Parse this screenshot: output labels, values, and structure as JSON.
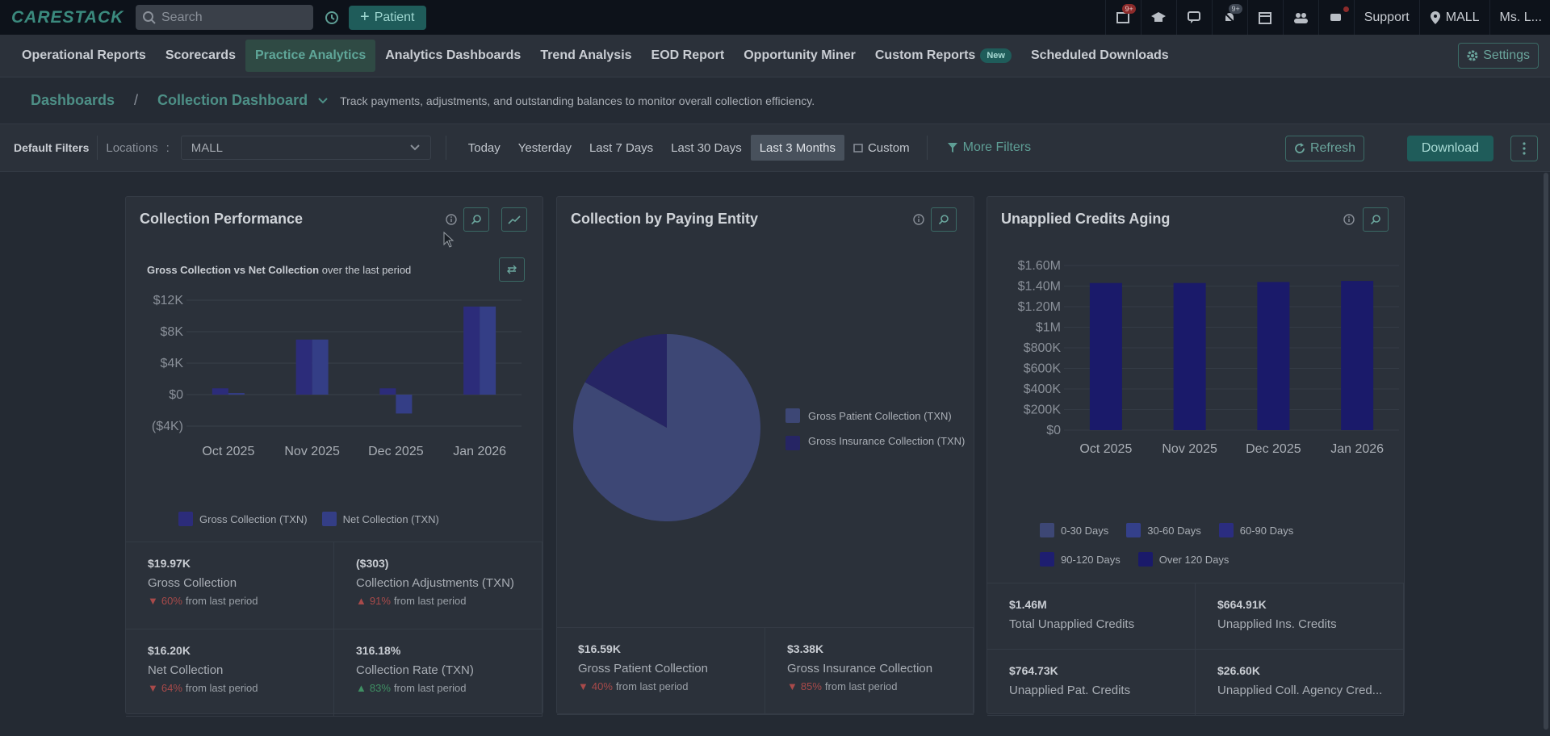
{
  "topbar": {
    "logo": "CARESTACK",
    "search_placeholder": "Search",
    "patient_label": "Patient",
    "badge1": "9+",
    "badge2": "9+",
    "support": "Support",
    "location": "MALL",
    "user": "Ms. L..."
  },
  "nav": {
    "items": [
      "Operational Reports",
      "Scorecards",
      "Practice Analytics",
      "Analytics Dashboards",
      "Trend Analysis",
      "EOD Report",
      "Opportunity Miner",
      "Custom Reports",
      "Scheduled Downloads"
    ],
    "new_badge": "New",
    "settings": "Settings"
  },
  "breadcrumb": {
    "root": "Dashboards",
    "sep": "/",
    "current": "Collection Dashboard",
    "description": "Track payments, adjustments, and outstanding balances to monitor overall collection efficiency."
  },
  "filters": {
    "label": "Default Filters",
    "locations_label": "Locations",
    "locations_sep": ":",
    "location_value": "MALL",
    "dates": [
      "Today",
      "Yesterday",
      "Last 7 Days",
      "Last 30 Days",
      "Last 3 Months"
    ],
    "custom": "Custom",
    "more_filters": "More Filters",
    "refresh": "Refresh",
    "download": "Download"
  },
  "colors": {
    "gross": "#2c2c7a",
    "net": "#343e86",
    "pie_patient": "#3d4775",
    "pie_insurance": "#262564",
    "aging_bar": "#1a1a6a"
  },
  "cards": {
    "performance": {
      "title": "Collection Performance",
      "subtitle_bold": "Gross Collection vs Net Collection",
      "subtitle_rest": " over the last period",
      "stats": [
        {
          "value": "$19.97K",
          "label": "Gross Collection",
          "pct": "60%",
          "from": "from last period",
          "dir": "down"
        },
        {
          "value": "($303)",
          "label": "Collection Adjustments (TXN)",
          "pct": "91%",
          "from": "from last period",
          "dir": "up"
        },
        {
          "value": "$16.20K",
          "label": "Net Collection",
          "pct": "64%",
          "from": "from last period",
          "dir": "down"
        },
        {
          "value": "316.18%",
          "label": "Collection Rate (TXN)",
          "pct": "83%",
          "from": "from last period",
          "dir": "up"
        }
      ]
    },
    "entity": {
      "title": "Collection by Paying Entity",
      "stats": [
        {
          "value": "$16.59K",
          "label": "Gross Patient Collection",
          "pct": "40%",
          "from": "from last period",
          "dir": "down"
        },
        {
          "value": "$3.38K",
          "label": "Gross Insurance Collection",
          "pct": "85%",
          "from": "from last period",
          "dir": "down"
        }
      ]
    },
    "aging": {
      "title": "Unapplied Credits Aging",
      "stats": [
        {
          "value": "$1.46M",
          "label": "Total Unapplied Credits"
        },
        {
          "value": "$664.91K",
          "label": "Unapplied Ins. Credits"
        },
        {
          "value": "$764.73K",
          "label": "Unapplied Pat. Credits"
        },
        {
          "value": "$26.60K",
          "label": "Unapplied Coll. Agency Cred..."
        }
      ]
    }
  },
  "chart_data": [
    {
      "type": "bar",
      "title": "Gross Collection vs Net Collection",
      "categories": [
        "Oct 2025",
        "Nov 2025",
        "Dec 2025",
        "Jan 2026"
      ],
      "series": [
        {
          "name": "Gross Collection (TXN)",
          "values": [
            800,
            7000,
            800,
            11200
          ]
        },
        {
          "name": "Net Collection (TXN)",
          "values": [
            200,
            7000,
            -2400,
            11200
          ]
        }
      ],
      "yticks": [
        "$12K",
        "$8K",
        "$4K",
        "$0",
        "($4K)"
      ],
      "ylim": [
        -4000,
        12000
      ]
    },
    {
      "type": "pie",
      "title": "Collection by Paying Entity",
      "labels": [
        "Gross Patient Collection (TXN)",
        "Gross Insurance Collection (TXN)"
      ],
      "values": [
        16590,
        3380
      ]
    },
    {
      "type": "bar",
      "title": "Unapplied Credits Aging",
      "categories": [
        "Oct 2025",
        "Nov 2025",
        "Dec 2025",
        "Jan 2026"
      ],
      "series": [
        {
          "name": "0-30 Days",
          "values": [
            0,
            0,
            0,
            0
          ]
        },
        {
          "name": "30-60 Days",
          "values": [
            0,
            0,
            0,
            0
          ]
        },
        {
          "name": "60-90 Days",
          "values": [
            0,
            0,
            0,
            0
          ]
        },
        {
          "name": "90-120 Days",
          "values": [
            0,
            0,
            0,
            0
          ]
        },
        {
          "name": "Over 120 Days",
          "values": [
            1430000,
            1430000,
            1440000,
            1450000
          ]
        }
      ],
      "yticks": [
        "$1.60M",
        "$1.40M",
        "$1.20M",
        "$1M",
        "$800K",
        "$600K",
        "$400K",
        "$200K",
        "$0"
      ],
      "ylim": [
        0,
        1600000
      ]
    }
  ]
}
